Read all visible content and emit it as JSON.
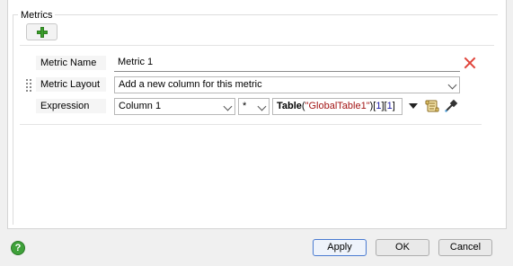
{
  "metrics_group": {
    "title": "Metrics",
    "add_icon": "green-plus-icon"
  },
  "metric": {
    "name_label": "Metric Name",
    "name_value": "Metric 1",
    "layout_label": "Metric Layout",
    "layout_value": "Add a new column for this metric",
    "expression_label": "Expression",
    "column_value": "Column 1",
    "operator_value": "*",
    "expression": {
      "func": "Table",
      "open": "(",
      "string": "\"GlobalTable1\"",
      "close": ")",
      "idx1_open": "[",
      "idx1": "1",
      "idx1_close": "]",
      "idx2_open": "[",
      "idx2": "1",
      "idx2_close": "]"
    },
    "remove_icon": "red-x-icon",
    "dropdown_icon": "triangle-down-icon",
    "script_icon": "script-scroll-icon",
    "picker_icon": "eyedropper-icon"
  },
  "footer": {
    "help_icon": "help-icon",
    "help_glyph": "?",
    "apply_label": "Apply",
    "ok_label": "OK",
    "cancel_label": "Cancel"
  },
  "colors": {
    "accent_green": "#3aa02b",
    "remove_red": "#e0443a",
    "primary_border": "#4a7bd1"
  }
}
